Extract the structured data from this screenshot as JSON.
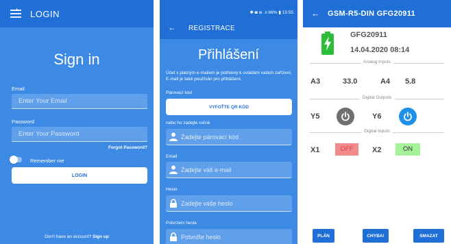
{
  "login": {
    "title": "LOGIN",
    "heading": "Sign in",
    "email_label": "Email",
    "email_placeholder": "Enter Your Email",
    "password_label": "Password",
    "password_placeholder": "Enter Your Password",
    "forgot": "Forgot Password?",
    "remember": "Remember me",
    "login_button": "LOGIN",
    "no_account": "Don't have an account?",
    "sign_up": "Sign up"
  },
  "registrace": {
    "status_bar": "✱ ◙ ⊜ .ıl 66% ▮ 15:55",
    "title": "REGISTRACE",
    "heading": "Přihlášení",
    "description": "Účet s platným e-mailem je potřebný k ovládání vašich zařízení. E-mail je také používán pro přihlášení.",
    "pair_label": "Párovací kód",
    "qr_button": "VYFOŤTE QR KÓD",
    "or_manual": "nebo ho zadejte ručně",
    "pair_placeholder": "Zadejte párovací kód",
    "email_label": "Email",
    "email_placeholder": "Zadejte váš e-mail",
    "password_label": "Heslo",
    "password_placeholder": "Zadejte vaše heslo",
    "confirm_label": "Potvrzení hesla",
    "confirm_placeholder": "Potvrďte heslo"
  },
  "device": {
    "title": "GSM-R5-DIN GFG20911",
    "name": "GFG20911",
    "datetime": "14.04.2020 08:14",
    "analog_title": "Analog Inputs",
    "a3_label": "A3",
    "a3_value": "33.0",
    "a4_label": "A4",
    "a4_value": "5.8",
    "outputs_title": "Digital Outputs",
    "y5_label": "Y5",
    "y6_label": "Y6",
    "inputs_title": "Digital Inputs",
    "x1_label": "X1",
    "x1_state": "OFF",
    "x2_label": "X2",
    "x2_state": "ON",
    "plan_button": "PLÁN",
    "error_button": "CHYBA!",
    "delete_button": "SMAZAT"
  },
  "colors": {
    "primary": "#1f6fd6",
    "background": "#3d8ae5",
    "off_bg": "#f28b8b",
    "on_bg": "#a6f29a",
    "battery": "#2ebd3a"
  }
}
